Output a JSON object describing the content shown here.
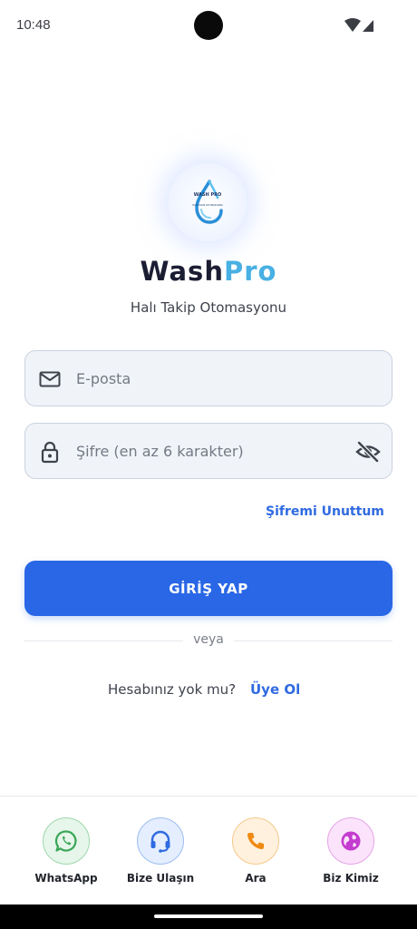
{
  "status_bar": {
    "time": "10:48"
  },
  "brand": {
    "name_part1": "Wash",
    "name_part2": "Pro",
    "tagline": "Halı Takip Otomasyonu",
    "logo_text": "WASH PRO",
    "logo_subtext": "HALI TAKIP OTOMASYONU"
  },
  "form": {
    "email_placeholder": "E-posta",
    "password_placeholder": "Şifre (en az 6 karakter)",
    "forgot_label": "Şifremi Unuttum",
    "login_label": "GİRİŞ YAP",
    "divider_text": "veya",
    "signup_prompt": "Hesabınız yok mu?",
    "signup_label": "Üye Ol"
  },
  "bottom_actions": [
    {
      "label": "WhatsApp",
      "icon": "whatsapp-icon",
      "color": "#3aa657"
    },
    {
      "label": "Bize Ulaşın",
      "icon": "headset-icon",
      "color": "#2f6ae0"
    },
    {
      "label": "Ara",
      "icon": "phone-icon",
      "color": "#ef8a14"
    },
    {
      "label": "Biz Kimiz",
      "icon": "globe-icon",
      "color": "#c43ccf"
    }
  ],
  "colors": {
    "primary": "#2967e6",
    "brand_dark": "#1b1d33",
    "brand_accent": "#48b0e3",
    "link": "#2f6ae0"
  }
}
